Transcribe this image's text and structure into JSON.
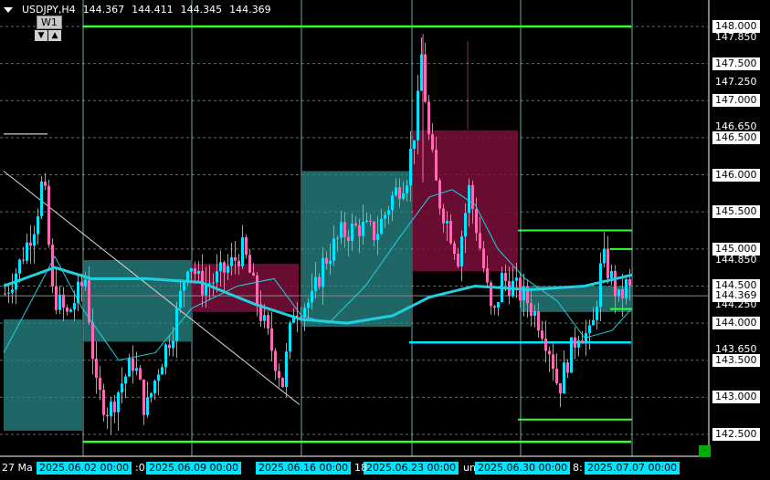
{
  "header": {
    "symbol": "USDJPY,H4",
    "open": "144.367",
    "high": "144.411",
    "low": "144.345",
    "close": "144.369",
    "timeframe_button": "W1"
  },
  "price_labels": [
    "148.000",
    "147.850",
    "147.500",
    "147.250",
    "147.000",
    "146.650",
    "146.500",
    "146.000",
    "145.500",
    "145.000",
    "144.850",
    "144.500",
    "144.369",
    "144.250",
    "144.000",
    "143.650",
    "143.500",
    "143.000",
    "142.500"
  ],
  "time_labels": [
    "2025.06.02 00:00",
    "2025.06.09 00:00",
    "2025.06.16 00:00",
    "2025.06.23 00:00",
    "2025.06.30 00:00",
    "2025.07.07 00:00"
  ],
  "time_fragments": [
    "27 Ma",
    ":0",
    "18",
    "un",
    "8:"
  ],
  "colors": {
    "background": "#000000",
    "bull_candle": "#00e5ff",
    "bear_candle": "#ff69b4",
    "teal_zone": "#2a8a8a",
    "maroon_zone": "#7a0f3a",
    "green_level": "#33ff33",
    "cyan_level": "#00e5ff",
    "ma_line": "#20d0e0"
  },
  "chart_data": {
    "type": "candlestick",
    "symbol": "USDJPY",
    "timeframe": "H4",
    "ylim": [
      142.25,
      148.4
    ],
    "current_price": 144.369,
    "weekly_separators": [
      "2025.06.02 00:00",
      "2025.06.09 00:00",
      "2025.06.16 00:00",
      "2025.06.23 00:00",
      "2025.06.30 00:00",
      "2025.07.07 00:00"
    ],
    "horizontal_levels": [
      148.0,
      142.4,
      143.74,
      145.25,
      142.7,
      145.0,
      144.19
    ],
    "zones": [
      {
        "kind": "demand",
        "from": "2025.05.27",
        "to": "2025.06.02",
        "low": 142.55,
        "high": 144.05
      },
      {
        "kind": "demand",
        "from": "2025.06.02",
        "to": "2025.06.09",
        "low": 143.75,
        "high": 144.85
      },
      {
        "kind": "supply",
        "from": "2025.06.09",
        "to": "2025.06.16",
        "low": 144.15,
        "high": 144.8
      },
      {
        "kind": "demand",
        "from": "2025.06.16",
        "to": "2025.06.23",
        "low": 143.95,
        "high": 146.05
      },
      {
        "kind": "supply",
        "from": "2025.06.23",
        "to": "2025.06.30",
        "low": 144.7,
        "high": 146.6
      },
      {
        "kind": "demand",
        "from": "2025.06.30",
        "to": "2025.07.07",
        "low": 144.15,
        "high": 144.5
      }
    ]
  }
}
